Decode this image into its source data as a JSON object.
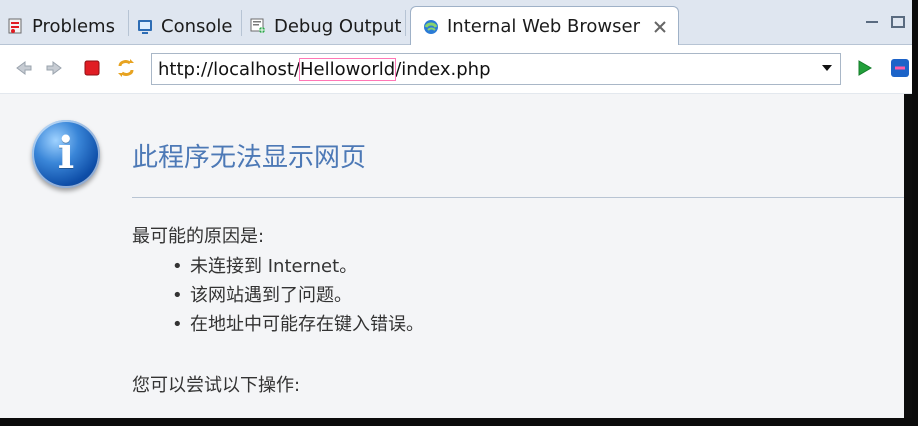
{
  "tabs": [
    {
      "label": "Problems",
      "icon": "problems-icon"
    },
    {
      "label": "Console",
      "icon": "console-icon"
    },
    {
      "label": "Debug Output",
      "icon": "debug-output-icon"
    },
    {
      "label": "Internal Web Browser",
      "icon": "globe-icon",
      "active": true
    }
  ],
  "toolbar": {
    "back_icon": "back-arrow-icon",
    "forward_icon": "forward-arrow-icon",
    "stop_icon": "stop-icon",
    "refresh_icon": "refresh-icon",
    "go_icon": "go-arrow-icon",
    "url_prefix": "http://localhost/",
    "url_highlight": "Helloworld",
    "url_suffix": "/index.php"
  },
  "page": {
    "title": "此程序无法显示网页",
    "reasons_title": "最可能的原因是:",
    "reasons": [
      "未连接到 Internet。",
      "该网站遇到了问题。",
      "在地址中可能存在键入错误。"
    ],
    "actions_title": "您可以尝试以下操作:"
  },
  "colors": {
    "title": "#4d79b6",
    "tabbar": "#dfe6f0",
    "stop": "#e01d24",
    "go": "#22a03a"
  }
}
